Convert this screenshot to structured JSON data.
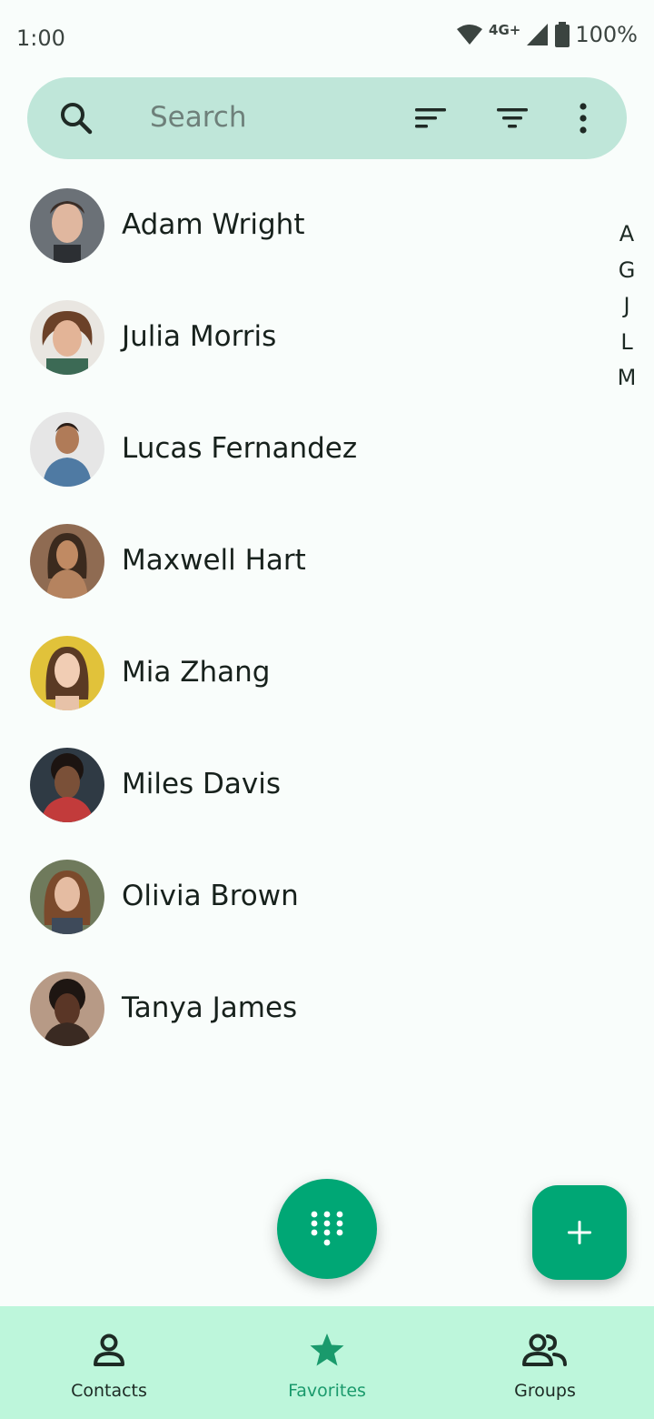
{
  "status_bar": {
    "time": "1:00",
    "network": "4G+",
    "battery": "100%"
  },
  "search": {
    "placeholder": "Search",
    "icons": [
      "search-icon",
      "sort-icon",
      "filter-icon",
      "more-vert-icon"
    ]
  },
  "contacts": [
    {
      "name": "Adam Wright"
    },
    {
      "name": "Julia Morris"
    },
    {
      "name": "Lucas Fernandez"
    },
    {
      "name": "Maxwell Hart"
    },
    {
      "name": "Mia Zhang"
    },
    {
      "name": "Miles Davis"
    },
    {
      "name": "Olivia Brown"
    },
    {
      "name": "Tanya James"
    }
  ],
  "alpha_index": [
    "A",
    "G",
    "J",
    "L",
    "M"
  ],
  "fab": {
    "dialpad_icon": "dialpad-icon",
    "add_icon": "plus-icon"
  },
  "bottom_nav": {
    "items": [
      {
        "label": "Contacts",
        "icon": "person-icon",
        "active": false
      },
      {
        "label": "Favorites",
        "icon": "star-icon",
        "active": true
      },
      {
        "label": "Groups",
        "icon": "group-icon",
        "active": false
      }
    ]
  },
  "colors": {
    "accent": "#00a775",
    "search_bg": "#bfe6d9",
    "nav_bg": "#bdf6db",
    "active_nav": "#1a9a6c"
  }
}
